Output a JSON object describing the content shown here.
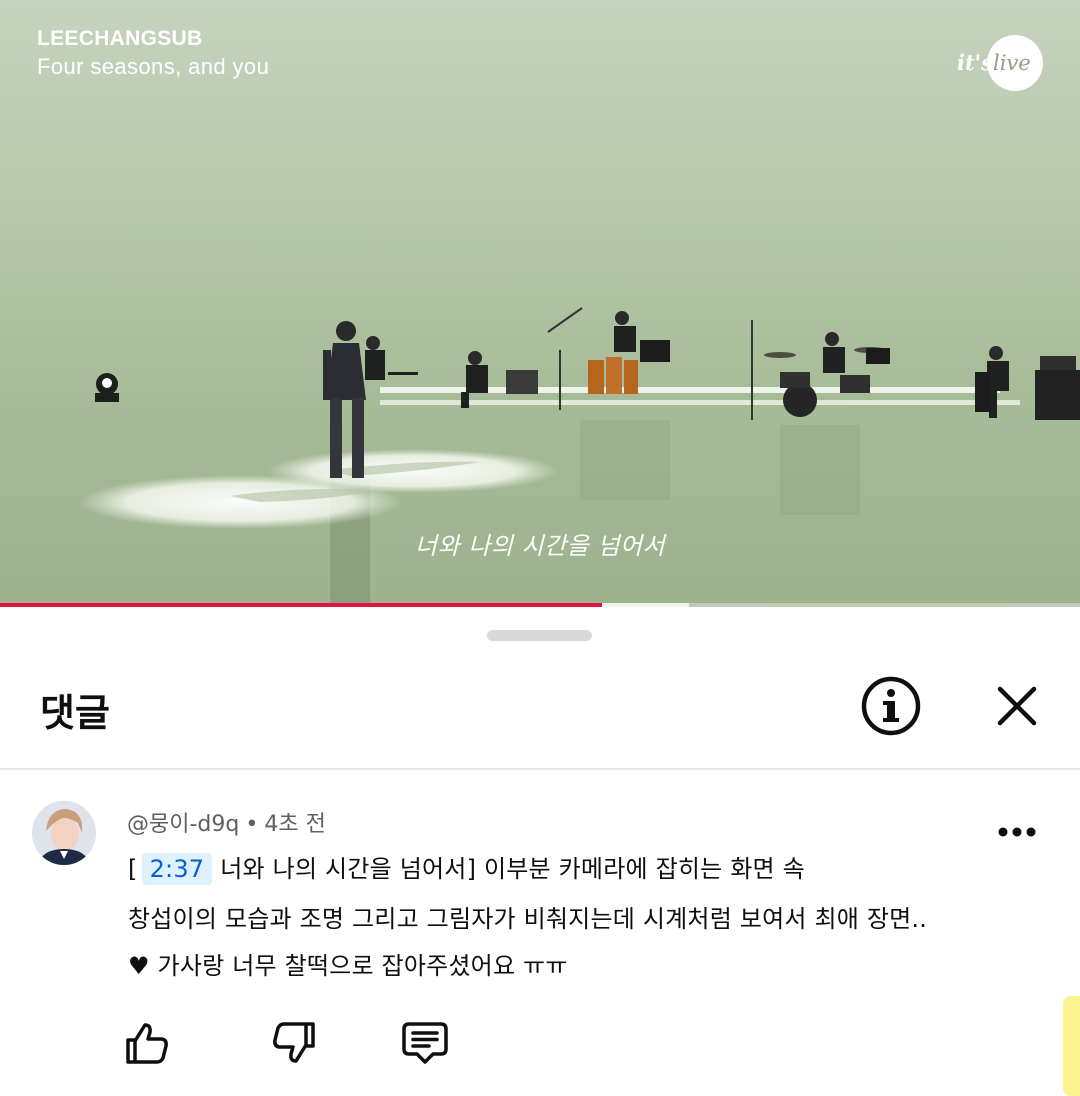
{
  "video": {
    "artist": "LEECHANGSUB",
    "song_title": "Four seasons, and you",
    "channel_logo_text": "it's live",
    "subtitle": "너와 나의 시간을 넘어서",
    "progress_played_fraction": 0.557,
    "progress_buffered_fraction": 0.638,
    "colors": {
      "played": "#e0143c"
    }
  },
  "comments_panel": {
    "title": "댓글",
    "info_icon": "info-circle-icon",
    "close_icon": "close-icon"
  },
  "comment": {
    "author": "@뭉이-d9q",
    "separator": "•",
    "time": "4초 전",
    "bracket_open": "[",
    "timestamp": "2:37",
    "line1_rest": "너와 나의 시간을 넘어서] 이부분 카메라에 잡히는 화면 속",
    "line2": "창섭이의 모습과 조명 그리고 그림자가 비춰지는데 시계처럼 보여서 최애 장면..",
    "line3": "♥ 가사랑 너무 찰떡으로 잡아주셨어요 ㅠㅠ",
    "actions": [
      "thumb-up-icon",
      "thumb-down-icon",
      "reply-icon"
    ],
    "menu_icon": "more-options-icon",
    "colors": {
      "timestamp_bg": "#def1ff",
      "timestamp_text": "#065fd4"
    }
  }
}
